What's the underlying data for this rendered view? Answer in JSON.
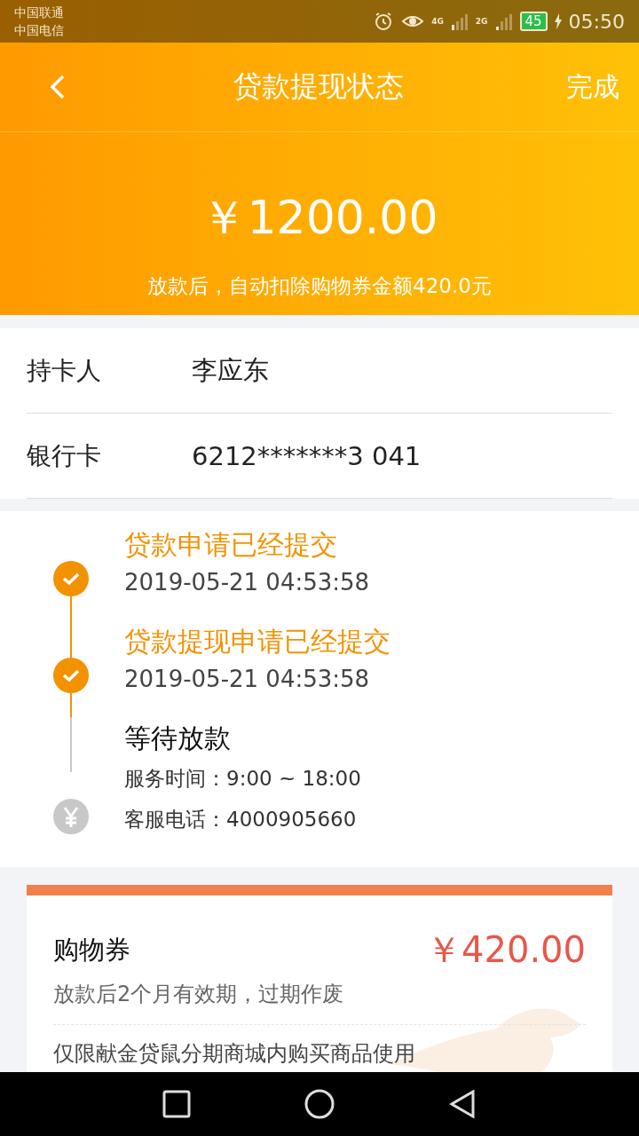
{
  "status_bar": {
    "carriers": [
      "中国联通",
      "中国电信"
    ],
    "network_1": "4G",
    "network_2": "2G",
    "battery": "45",
    "time": "05:50"
  },
  "header": {
    "title": "贷款提现状态",
    "action": "完成"
  },
  "amount": {
    "value": "￥1200.00",
    "note": "放款后，自动扣除购物券金额420.0元"
  },
  "info_rows": [
    {
      "label": "持卡人",
      "value": "李应东"
    },
    {
      "label": "银行卡",
      "value": "6212*******3 041"
    }
  ],
  "timeline": [
    {
      "title": "贷款申请已经提交",
      "done": true,
      "lines": [
        "2019-05-21 04:53:58"
      ]
    },
    {
      "title": "贷款提现申请已经提交",
      "done": true,
      "lines": [
        "2019-05-21 04:53:58"
      ]
    },
    {
      "title": "等待放款",
      "done": false,
      "lines": [
        "服务时间：9:00 ~ 18:00",
        "客服电话：4000905660"
      ]
    }
  ],
  "coupon": {
    "title": "购物券",
    "amount": "￥420.00",
    "validity": "放款后2个月有效期，过期作废",
    "rule": "仅限献金贷鼠分期商城内购买商品使用"
  }
}
